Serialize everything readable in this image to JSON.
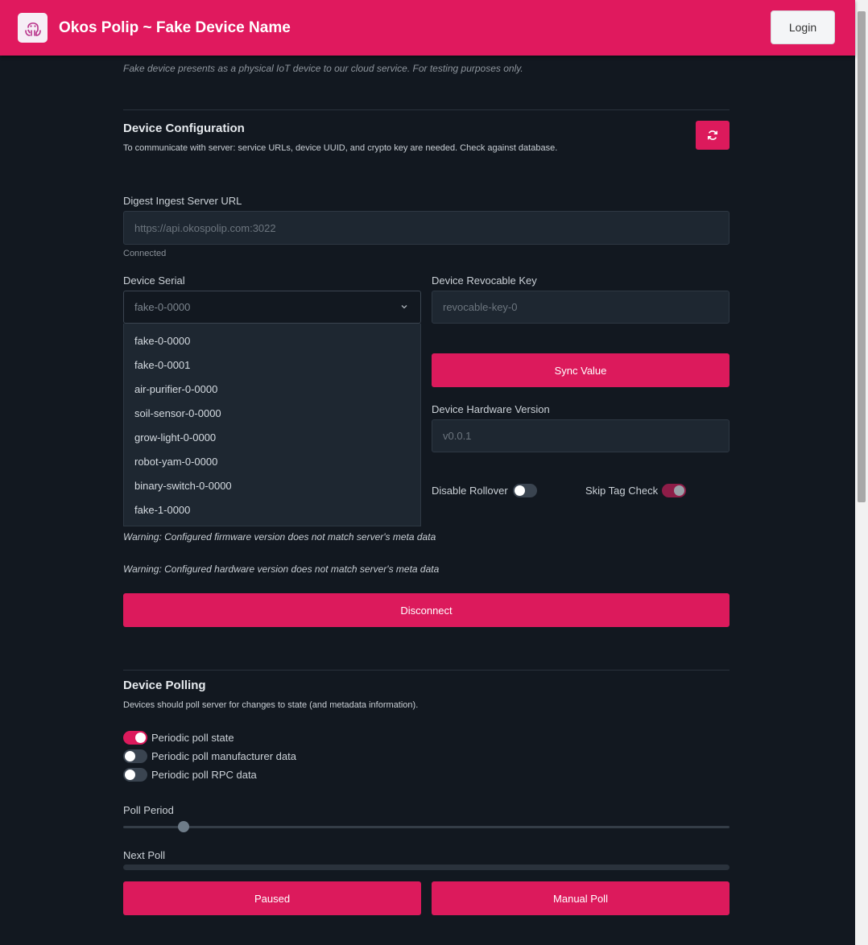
{
  "header": {
    "title": "Okos Polip ~ Fake Device Name",
    "login_label": "Login"
  },
  "subtitle": "Fake device presents as a physical IoT device to our cloud service. For testing purposes only.",
  "config": {
    "title": "Device Configuration",
    "description": "To communicate with server: service URLs, device UUID, and crypto key are needed. Check against database.",
    "refresh_icon": "refresh-icon",
    "digest_label": "Digest Ingest Server URL",
    "digest_value": "https://api.okospolip.com:3022",
    "connection_status": "Connected",
    "serial_label": "Device Serial",
    "serial_value": "fake-0-0000",
    "serial_options": [
      "fake-0-0000",
      "fake-0-0001",
      "air-purifier-0-0000",
      "soil-sensor-0-0000",
      "grow-light-0-0000",
      "robot-yam-0-0000",
      "binary-switch-0-0000",
      "fake-1-0000"
    ],
    "revocable_label": "Device Revocable Key",
    "revocable_value": "revocable-key-0",
    "sync_label": "Sync Value",
    "hw_label": "Device Hardware Version",
    "hw_value": "v0.0.1",
    "disable_rollover_label": "Disable Rollover",
    "disable_rollover_on": false,
    "skip_tag_label": "Skip Tag Check",
    "skip_tag_on": true,
    "warning_firmware": "Warning: Configured firmware version does not match server's meta data",
    "warning_hardware": "Warning: Configured hardware version does not match server's meta data",
    "disconnect_label": "Disconnect"
  },
  "polling": {
    "title": "Device Polling",
    "description": "Devices should poll server for changes to state (and metadata information).",
    "options": [
      {
        "label": "Periodic poll state",
        "on": true
      },
      {
        "label": "Periodic poll manufacturer data",
        "on": false
      },
      {
        "label": "Periodic poll RPC data",
        "on": false
      }
    ],
    "period_label": "Poll Period",
    "period_fraction": 0.1,
    "next_label": "Next Poll",
    "next_progress": 0,
    "paused_label": "Paused",
    "manual_label": "Manual Poll"
  },
  "colors": {
    "accent": "#dc1a5c",
    "background": "#121820",
    "field": "#1e2731"
  }
}
